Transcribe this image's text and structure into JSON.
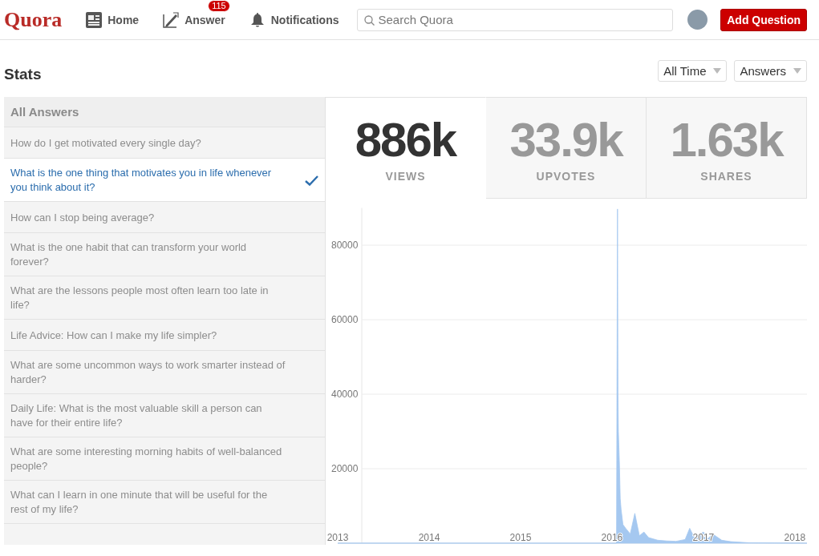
{
  "header": {
    "logo": "Quora",
    "nav": [
      {
        "kind": "home",
        "label": "Home"
      },
      {
        "kind": "answer",
        "label": "Answer",
        "badge": "115"
      },
      {
        "kind": "notifications",
        "label": "Notifications"
      }
    ],
    "search": {
      "placeholder": "Search Quora"
    },
    "add_button": "Add Question"
  },
  "page_title": "Stats",
  "filters": [
    "All Time",
    "Answers"
  ],
  "list": {
    "heading": "All Answers",
    "items": [
      {
        "text": "How do I get motivated every single day?",
        "selected": false
      },
      {
        "text": "What is the one thing that motivates you in life whenever you think about it?",
        "selected": true
      },
      {
        "text": "How can I stop being average?",
        "selected": false
      },
      {
        "text": "What is the one habit that can transform your world forever?",
        "selected": false
      },
      {
        "text": "What are the lessons people most often learn too late in life?",
        "selected": false
      },
      {
        "text": "Life Advice: How can I make my life simpler?",
        "selected": false
      },
      {
        "text": "What are some uncommon ways to work smarter instead of harder?",
        "selected": false
      },
      {
        "text": "Daily Life: What is the most valuable skill a person can have for their entire life?",
        "selected": false
      },
      {
        "text": "What are some interesting morning habits of well-balanced people?",
        "selected": false
      },
      {
        "text": "What can I learn in one minute that will be useful for the rest of my life?",
        "selected": false
      }
    ]
  },
  "metrics": [
    {
      "value": "886k",
      "label": "VIEWS",
      "selected": true
    },
    {
      "value": "33.9k",
      "label": "UPVOTES",
      "selected": false
    },
    {
      "value": "1.63k",
      "label": "SHARES",
      "selected": false
    }
  ],
  "chart": {
    "chart_data": {
      "type": "area",
      "x": [
        2013,
        2016.05,
        2016.06,
        2016.065,
        2016.07,
        2016.08,
        2016.09,
        2016.1,
        2016.12,
        2016.15,
        2016.2,
        2016.25,
        2016.3,
        2016.35,
        2016.4,
        2016.5,
        2016.6,
        2016.7,
        2016.8,
        2016.85,
        2016.9,
        2017.0,
        2017.05,
        2017.1,
        2017.2,
        2017.3,
        2017.5,
        2018.15
      ],
      "series": [
        {
          "color": "#a5c8f0",
          "values": [
            0,
            0,
            89700,
            40000,
            30000,
            22000,
            12000,
            9000,
            5000,
            4000,
            2500,
            8000,
            2000,
            3000,
            1500,
            800,
            600,
            500,
            1000,
            4000,
            1500,
            3000,
            1200,
            2500,
            800,
            400,
            100,
            0
          ]
        }
      ],
      "xlim": [
        2013,
        2018.15
      ],
      "ylim": [
        0,
        90000
      ],
      "grid": true,
      "xticks": [
        2013,
        2014,
        2015,
        2016,
        2017,
        2018
      ],
      "yticks": [
        20000,
        40000,
        60000,
        80000
      ]
    }
  }
}
